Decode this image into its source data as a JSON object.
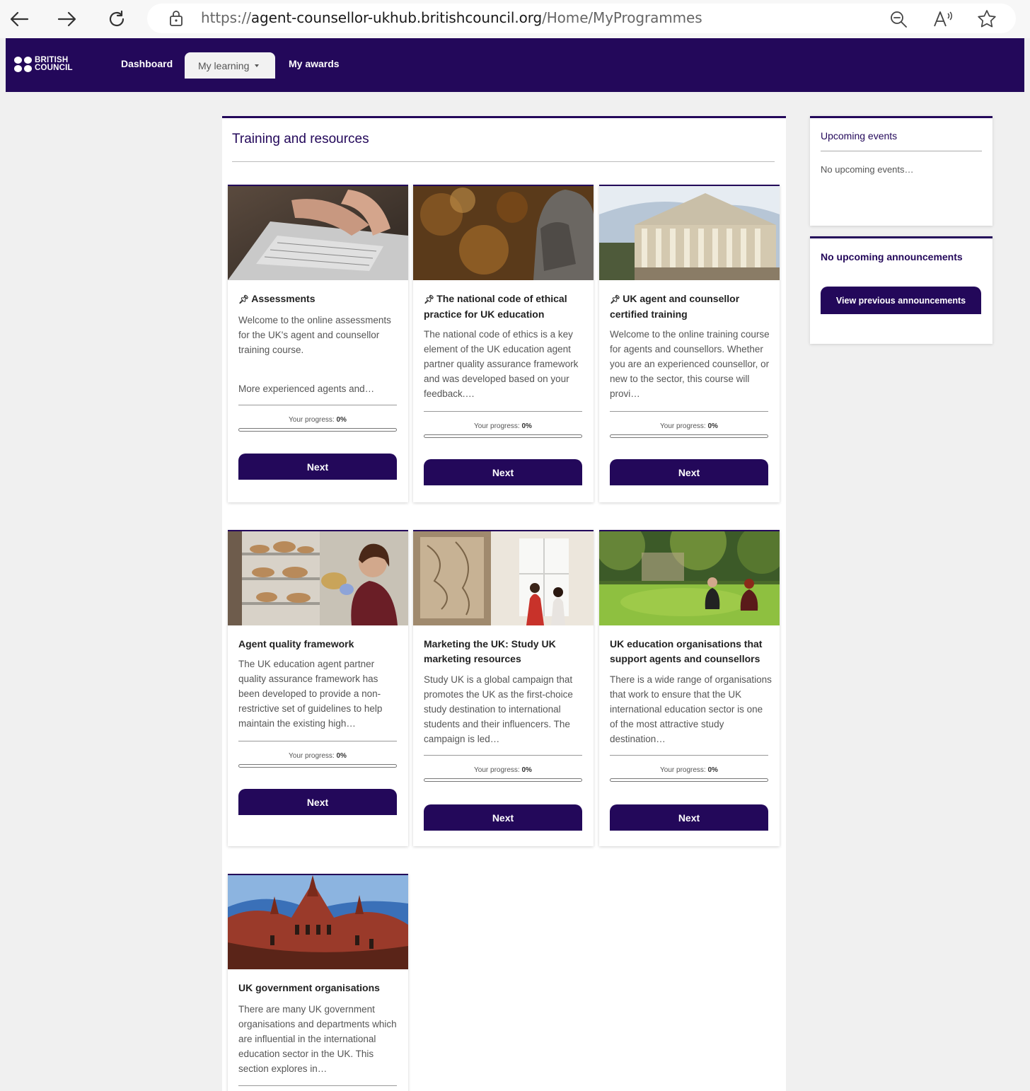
{
  "browser": {
    "url_prefix": "https://",
    "url_host": "agent-counsellor-ukhub.britishcouncil.org",
    "url_path": "/Home/MyProgrammes"
  },
  "header": {
    "logo_line1": "BRITISH",
    "logo_line2": "COUNCIL",
    "nav": {
      "dashboard": "Dashboard",
      "my_learning": "My learning",
      "my_awards": "My awards"
    }
  },
  "main": {
    "title": "Training and resources",
    "progress_label": "Your progress:",
    "cards": [
      {
        "title": "Assessments",
        "pinned": true,
        "desc1": "Welcome to the online assessments for the UK's agent and counsellor training course.",
        "desc2": "More experienced agents and…",
        "progress": "0%",
        "progress_value": 0,
        "button": "Next"
      },
      {
        "title": "The national code of ethical practice for UK education",
        "pinned": true,
        "desc1": "The national code of ethics is a key element of the UK education agent partner quality assurance framework and was developed based on your feedback.…",
        "progress": "0%",
        "progress_value": 0,
        "button": "Next"
      },
      {
        "title": "UK agent and counsellor certified training",
        "pinned": true,
        "desc1": "Welcome to the online training course for agents and counsellors. Whether you are an experienced counsellor, or new to the sector, this course will provi…",
        "progress": "0%",
        "progress_value": 0,
        "button": "Next"
      },
      {
        "title": "Agent quality framework",
        "pinned": false,
        "desc1": "The UK education agent partner quality assurance framework has been developed to provide a non-restrictive set of guidelines to help maintain the existing high…",
        "progress": "0%",
        "progress_value": 0,
        "button": "Next"
      },
      {
        "title": "Marketing the UK: Study UK marketing resources",
        "pinned": false,
        "desc1": "Study UK is a global campaign that promotes the UK as the first-choice study destination to international students and their influencers. The campaign is led…",
        "progress": "0%",
        "progress_value": 0,
        "button": "Next"
      },
      {
        "title": "UK education organisations that support agents and counsellors",
        "pinned": false,
        "desc1": "There is a wide range of organisations that work to ensure that the UK international education sector is one of the most attractive study destination…",
        "progress": "0%",
        "progress_value": 0,
        "button": "Next"
      },
      {
        "title": "UK government organisations",
        "pinned": false,
        "desc1": "There are many UK government organisations and departments which are influential in the international education sector in the UK. This section explores in…"
      }
    ]
  },
  "sidebar": {
    "events_title": "Upcoming events",
    "events_empty": "No upcoming events…",
    "announcements_title": "No upcoming announcements",
    "announcements_button": "View previous announcements"
  },
  "colors": {
    "brand": "#23085a",
    "page_bg": "#f0f0f0"
  },
  "icons": [
    "back-arrow-icon",
    "forward-arrow-icon",
    "refresh-icon",
    "lock-icon",
    "zoom-out-icon",
    "read-aloud-icon",
    "favorite-star-icon",
    "pin-icon"
  ]
}
